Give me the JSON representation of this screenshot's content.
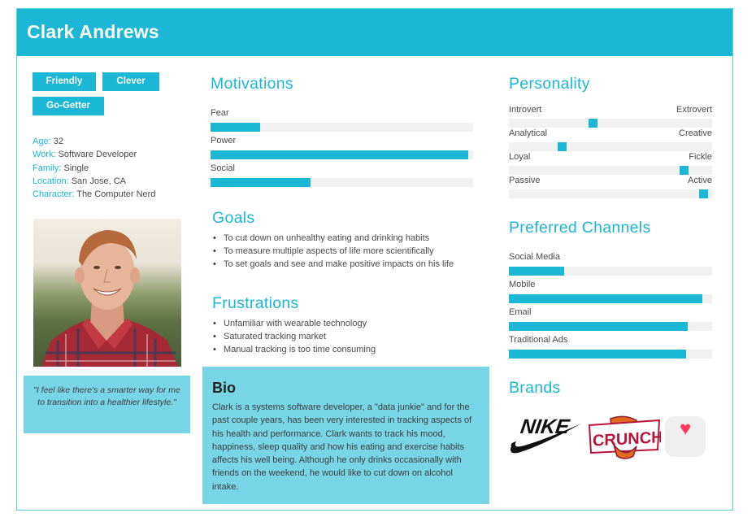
{
  "persona": {
    "name": "Clark Andrews",
    "tags": [
      "Friendly",
      "Clever",
      "Go-Getter"
    ],
    "facts": [
      {
        "key": "Age:",
        "value": "32"
      },
      {
        "key": "Work:",
        "value": "Software Developer"
      },
      {
        "key": "Family:",
        "value": "Single"
      },
      {
        "key": "Location:",
        "value": "San Jose, CA"
      },
      {
        "key": "Character:",
        "value": "The Computer Nerd"
      }
    ],
    "photo_alt": "Portrait of smiling man with red hair in plaid shirt",
    "quote": "\"I feel like there's a smarter way for me to transition into a healthier lifestyle.\""
  },
  "motivations": {
    "title": "Motivations",
    "items": [
      {
        "label": "Fear",
        "value": 0.19
      },
      {
        "label": "Power",
        "value": 0.98
      },
      {
        "label": "Social",
        "value": 0.38
      }
    ]
  },
  "goals": {
    "title": "Goals",
    "items": [
      "To cut down on unhealthy eating and drinking habits",
      "To measure multiple aspects of life more scientifically",
      "To set goals and see and make positive impacts on his life"
    ]
  },
  "frustrations": {
    "title": "Frustrations",
    "items": [
      "Unfamiliar with wearable technology",
      "Saturated tracking market",
      "Manual tracking is too time consuming"
    ]
  },
  "bio": {
    "title": "Bio",
    "text": "Clark is a systems software developer, a \"data junkie\" and for the past couple years, has been very interested in tracking aspects of his health and performance. Clark wants to track his mood, happiness, sleep quality and how his eating and exercise habits affects his well being. Although he only drinks occasionally with friends on the weekend, he would like to cut down on alcohol intake."
  },
  "personality": {
    "title": "Personality",
    "scales": [
      {
        "left": "Introvert",
        "right": "Extrovert",
        "value": 0.41
      },
      {
        "left": "Analytical",
        "right": "Creative",
        "value": 0.25
      },
      {
        "left": "Loyal",
        "right": "Fickle",
        "value": 0.88
      },
      {
        "left": "Passive",
        "right": "Active",
        "value": 0.98
      }
    ]
  },
  "channels": {
    "title": "Preferred Channels",
    "items": [
      {
        "label": "Social Media",
        "value": 0.27
      },
      {
        "label": "Mobile",
        "value": 0.95
      },
      {
        "label": "Email",
        "value": 0.88
      },
      {
        "label": "Traditional Ads",
        "value": 0.87
      }
    ]
  },
  "brands": {
    "title": "Brands",
    "items": [
      {
        "name": "Nike",
        "icon": "nike-logo",
        "text": "NIKE"
      },
      {
        "name": "Crunch",
        "icon": "crunch-logo",
        "text": "CRUNCH"
      },
      {
        "name": "Apple Health",
        "icon": "apple-health-icon",
        "text": "♥"
      }
    ]
  },
  "colors": {
    "accent": "#1bb7d4",
    "panel": "#78d5e5",
    "track": "#f1f1f1"
  }
}
